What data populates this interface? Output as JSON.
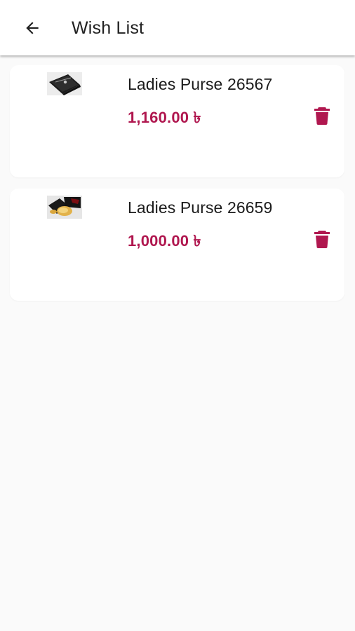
{
  "header": {
    "title": "Wish List",
    "back_icon": "arrow-back-icon"
  },
  "colors": {
    "accent": "#b0174f",
    "background": "#fafafa",
    "card": "#ffffff"
  },
  "items": [
    {
      "name": "Ladies Purse 26567",
      "price": "1,160.00 ৳",
      "image_icon": "black-purse-thumbnail",
      "action_icon": "trash-icon"
    },
    {
      "name": "Ladies Purse 26659",
      "price": "1,000.00 ৳",
      "image_icon": "black-gold-purse-thumbnail",
      "action_icon": "trash-icon"
    }
  ]
}
